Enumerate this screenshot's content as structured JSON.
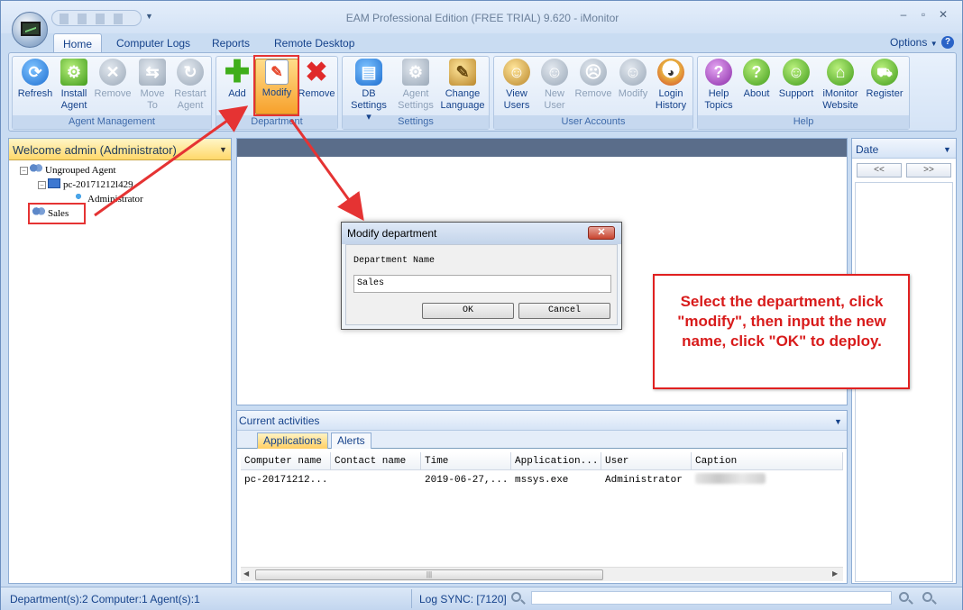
{
  "window": {
    "title": "EAM Professional Edition (FREE TRIAL) 9.620 - iMonitor",
    "controls": [
      "–",
      "▫",
      "✕"
    ]
  },
  "tabs": [
    "Home",
    "Computer Logs",
    "Reports",
    "Remote Desktop"
  ],
  "options_label": "Options",
  "help_glyph": "?",
  "ribbon": {
    "groups": {
      "agent_management": "Agent Management",
      "department": "Department",
      "settings": "Settings",
      "user_accounts": "User Accounts",
      "help": "Help"
    },
    "buttons": {
      "refresh": {
        "l1": "Refresh",
        "l2": ""
      },
      "install_agent": {
        "l1": "Install",
        "l2": "Agent"
      },
      "remove_agent": {
        "l1": "Remove",
        "l2": ""
      },
      "move_to": {
        "l1": "Move",
        "l2": "To"
      },
      "restart_agent": {
        "l1": "Restart",
        "l2": "Agent"
      },
      "add": {
        "l1": "Add",
        "l2": ""
      },
      "modify": {
        "l1": "Modify",
        "l2": ""
      },
      "remove_dept": {
        "l1": "Remove",
        "l2": ""
      },
      "db_settings": {
        "l1": "DB",
        "l2": "Settings ▾"
      },
      "agent_settings": {
        "l1": "Agent",
        "l2": "Settings"
      },
      "change_language": {
        "l1": "Change",
        "l2": "Language"
      },
      "view_users": {
        "l1": "View",
        "l2": "Users"
      },
      "new_user": {
        "l1": "New",
        "l2": "User"
      },
      "remove_user": {
        "l1": "Remove",
        "l2": ""
      },
      "modify_user": {
        "l1": "Modify",
        "l2": ""
      },
      "login_history": {
        "l1": "Login",
        "l2": "History"
      },
      "help_topics": {
        "l1": "Help",
        "l2": "Topics"
      },
      "about": {
        "l1": "About",
        "l2": ""
      },
      "support": {
        "l1": "Support",
        "l2": ""
      },
      "imonitor_website": {
        "l1": "iMonitor",
        "l2": "Website"
      },
      "register": {
        "l1": "Register",
        "l2": ""
      }
    }
  },
  "left_panel": {
    "title": "Welcome admin (Administrator)",
    "tree": {
      "ungrouped": "Ungrouped Agent",
      "pc": "pc-20171212l429",
      "admin": "Administrator",
      "sales": "Sales"
    }
  },
  "activities": {
    "title": "Current activities",
    "subtabs": [
      "Applications",
      "Alerts"
    ],
    "columns": [
      "Computer name",
      "Contact name",
      "Time",
      "Application...",
      "User",
      "Caption"
    ],
    "rows": [
      [
        "pc-20171212...",
        "",
        "2019-06-27,...",
        "mssys.exe",
        "Administrator",
        ""
      ]
    ]
  },
  "right_panel": {
    "title": "Date",
    "prev": "<<",
    "next": ">>"
  },
  "dialog": {
    "title": "Modify department",
    "label": "Department Name",
    "value": "Sales",
    "ok": "OK",
    "cancel": "Cancel"
  },
  "callout": {
    "text": "Select the department, click \"modify\", then input the new name, click \"OK\" to deploy."
  },
  "status": {
    "left": "Department(s):2  Computer:1  Agent(s):1",
    "sync": "Log SYNC: [7120]"
  },
  "colors": {
    "accent": "#15428b",
    "highlight": "#e53333",
    "callout_text": "#d81b1b"
  }
}
